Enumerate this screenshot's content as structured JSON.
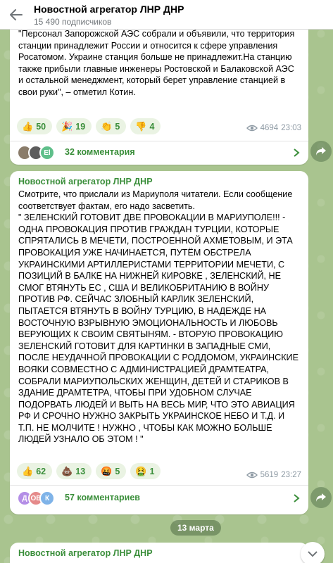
{
  "header": {
    "title": "Новостной агрегатор ЛНР ДНР",
    "subscribers": "15 490 подписчиков"
  },
  "post1": {
    "text": "\"Персонал Запорожской АЭС собрали и объявили, что территория станции принадлежит России и относится к сфере управления Росатомом. Украине станция больше не принадлежит.На станцию также прибыли главные инженеры Ростовской и Балаковской АЭС и остальной менеджмент, который берет управление станцией в свои руки\", – отметил Котин.",
    "reactions": [
      {
        "emoji": "👍",
        "count": "50"
      },
      {
        "emoji": "🎉",
        "count": "19"
      },
      {
        "emoji": "👏",
        "count": "5"
      },
      {
        "emoji": "👎",
        "count": "4"
      }
    ],
    "views": "4694",
    "time": "23:03",
    "comments": "32 комментария",
    "avatars": [
      {
        "label": "",
        "color": "#8a7c6a"
      },
      {
        "label": "",
        "color": "#5c5c5c"
      },
      {
        "label": "El",
        "color": "#5fbf8a"
      }
    ]
  },
  "post2": {
    "sender": "Новостной агрегатор ЛНР ДНР",
    "text": "Смотрите, что прислали из Мариуполя читатели. Если сообщение соответствует фактам, его надо засветить.\n\" ЗЕЛЕНСКИЙ ГОТОВИТ ДВЕ ПРОВОКАЦИИ В МАРИУПОЛЕ!!! - ОДНА ПРОВОКАЦИЯ ПРОТИВ ГРАЖДАН ТУРЦИИ, КОТОРЫЕ СПРЯТАЛИСЬ В МЕЧЕТИ, ПОСТРОЕННОЙ АХМЕТОВЫМ, И ЭТА ПРОВОКАЦИЯ УЖЕ НАЧИНАЕТСЯ, ПУТЁМ ОБСТРЕЛА УКРАИНСКИМИ АРТИЛЛЕРИСТАМИ ТЕРРИТОРИИ МЕЧЕТИ, С ПОЗИЦИЙ В БАЛКЕ НА НИЖНЕЙ КИРОВКЕ , ЗЕЛЕНСКИЙ, НЕ СМОГ ВТЯНУТЬ ЕС , США И ВЕЛИКОБРИТАНИЮ В ВОЙНУ ПРОТИВ РФ. СЕЙЧАС ЗЛОБНЫЙ КАРЛИК ЗЕЛЕНСКИЙ, ПЫТАЕТСЯ ВТЯНУТЬ В ВОЙНУ ТУРЦИЮ, В НАДЕЖДЕ НА ВОСТОЧНУЮ ВЗРЫВНУЮ ЭМОЦИОНАЛЬНОСТЬ И ЛЮБОВЬ ВЕРУЮЩИХ К СВОИМ СВЯТЫНЯМ. - ВТОРУЮ ПРОВОКАЦИЮ ЗЕЛЕНСКИЙ ГОТОВИТ ДЛЯ КАРТИНКИ В ЗАПАДНЫЕ СМИ, ПОСЛЕ НЕУДАЧНОЙ ПРОВОКАЦИИ С РОДДОМОМ, УКРАИНСКИЕ ВОЯКИ СОВМЕСТНО С АДМИНИСТРАЦИЕЙ ДРАМТЕАТРА, СОБРАЛИ МАРИУПОЛЬСКИХ ЖЕНЩИН, ДЕТЕЙ И СТАРИКОВ В ЗДАНИЕ ДРАМТЕТРА, ЧТОБЫ ПРИ УДОБНОМ СЛУЧАЕ ПОДОРВАТЬ ЛЮДЕЙ И ВЫТЬ НА ВЕСЬ МИР, ЧТО ЭТО АВИАЦИЯ РФ И СРОЧНО НУЖНО ЗАКРЫТЬ УКРАИНСКОЕ НЕБО И Т.Д. И Т.П. НЕ МОЛЧИТЕ ! НУЖНО , ЧТОБЫ КАК МОЖНО БОЛЬШЕ ЛЮДЕЙ УЗНАЛО ОБ ЭТОМ ! \"",
    "reactions": [
      {
        "emoji": "👍",
        "count": "62"
      },
      {
        "emoji": "💩",
        "count": "13"
      },
      {
        "emoji": "🤬",
        "count": "5"
      },
      {
        "emoji": "🤮",
        "count": "1"
      }
    ],
    "views": "5619",
    "time": "23:27",
    "comments": "57 комментариев",
    "avatars": [
      {
        "label": "Д",
        "color": "#b48ee6"
      },
      {
        "label": "ОВ",
        "color": "#e58a8a"
      },
      {
        "label": "К",
        "color": "#7fb3e8"
      }
    ]
  },
  "date_separator": "13 марта",
  "post3": {
    "sender": "Новостной агрегатор ЛНР ДНР"
  },
  "colors": {
    "accent": "#3a8e3a",
    "background": "#a9c48f",
    "meta": "#8e9aa4"
  }
}
